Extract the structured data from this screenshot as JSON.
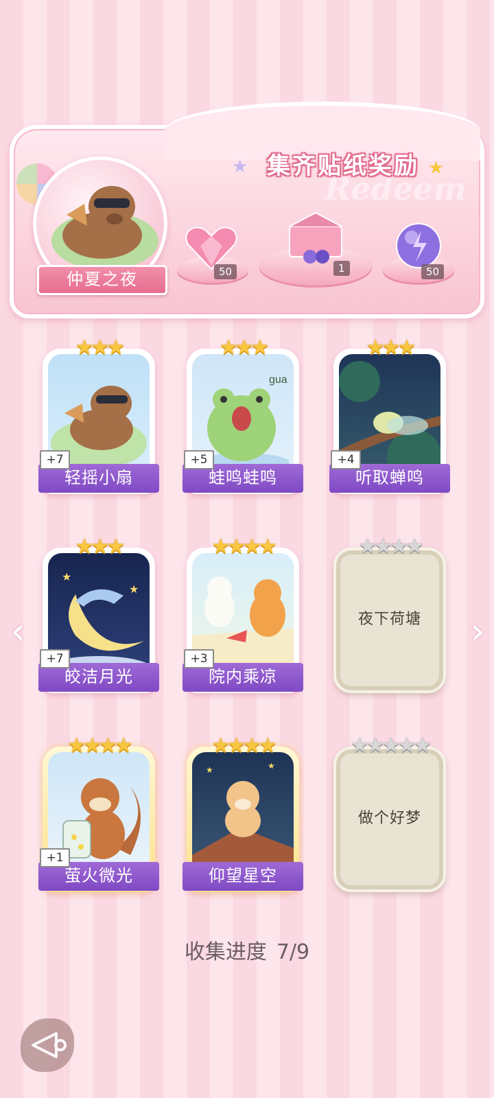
{
  "banner": {
    "title": "集齐贴纸奖励",
    "watermark": "Redeem",
    "event_name": "仲夏之夜",
    "rewards": [
      {
        "icon": "pink-heart-gem-icon",
        "count": "50"
      },
      {
        "icon": "gift-box-icon",
        "count": "1"
      },
      {
        "icon": "purple-energy-orb-icon",
        "count": "50"
      }
    ]
  },
  "stickers": [
    {
      "name": "轻摇小扇",
      "stars": 3,
      "bonus": "+7",
      "collected": true,
      "art": "capybara-fan",
      "frame": "white"
    },
    {
      "name": "蛙鸣蛙鸣",
      "stars": 3,
      "bonus": "+5",
      "collected": true,
      "art": "frog-gua",
      "frame": "white",
      "art_text": "gua"
    },
    {
      "name": "听取蝉鸣",
      "stars": 3,
      "bonus": "+4",
      "collected": true,
      "art": "cicada-branch",
      "frame": "white"
    },
    {
      "name": "皎洁月光",
      "stars": 3,
      "bonus": "+7",
      "collected": true,
      "art": "sleepy-moon",
      "frame": "white"
    },
    {
      "name": "院内乘凉",
      "stars": 4,
      "bonus": "+3",
      "collected": true,
      "art": "cats-watermelon",
      "frame": "white"
    },
    {
      "name": "夜下荷塘",
      "stars": 4,
      "bonus": "",
      "collected": false,
      "art": "locked",
      "frame": "locked"
    },
    {
      "name": "萤火微光",
      "stars": 4,
      "bonus": "+1",
      "collected": true,
      "art": "squirrel-firefly-jar",
      "frame": "gold"
    },
    {
      "name": "仰望星空",
      "stars": 4,
      "bonus": "",
      "collected": true,
      "art": "hamster-rooftop",
      "frame": "gold"
    },
    {
      "name": "做个好梦",
      "stars": 5,
      "bonus": "",
      "collected": false,
      "art": "locked",
      "frame": "locked"
    }
  ],
  "navigation": {
    "prev_icon": "chevron-left-icon",
    "next_icon": "chevron-right-icon"
  },
  "progress": {
    "label": "收集进度",
    "value": "7/9"
  },
  "colors": {
    "background": "#fbd9e2",
    "label_purple": "#8b55cc",
    "star_gold": "#f8c63f",
    "ribbon_pink": "#e56c8f"
  }
}
